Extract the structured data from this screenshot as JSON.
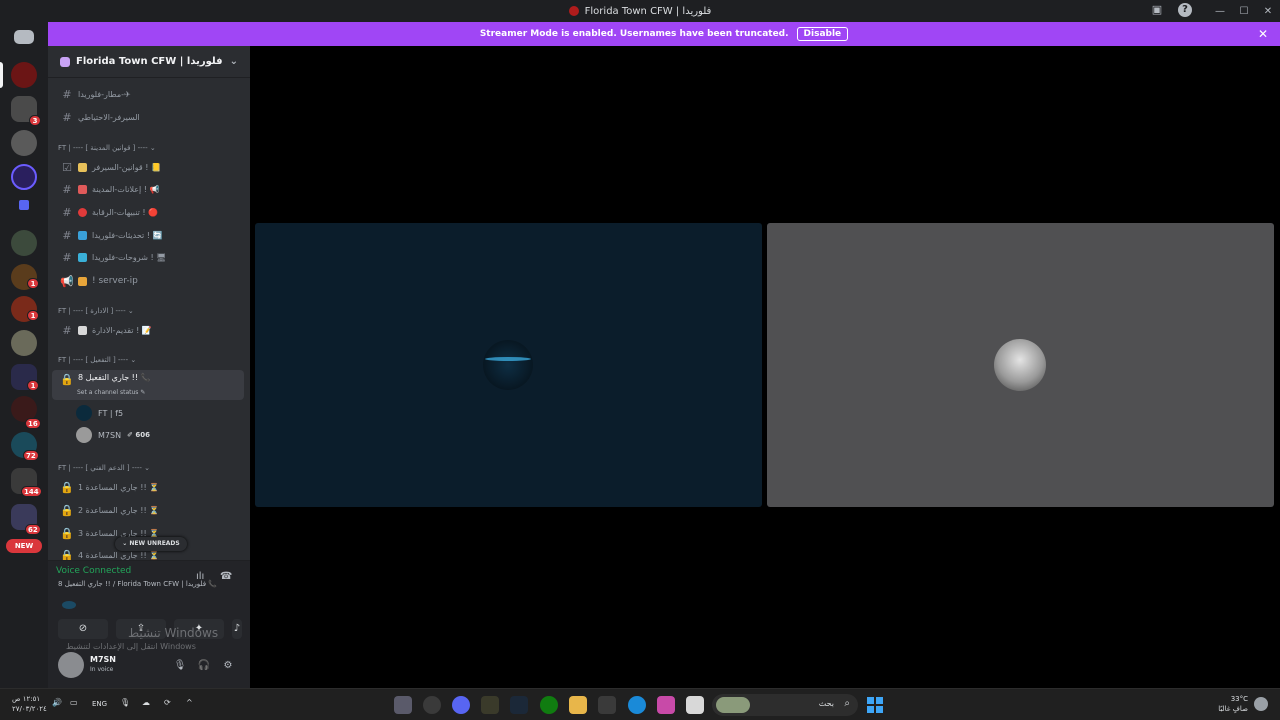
{
  "window": {
    "title": "Florida Town CFW | فلوريدا"
  },
  "banner": {
    "text": "Streamer Mode is enabled. Usernames have been truncated.",
    "disable_label": "Disable"
  },
  "rail": {
    "badges": [
      "3",
      "1",
      "1",
      "1",
      "16",
      "72",
      "144",
      "62"
    ],
    "new_label": "NEW"
  },
  "sidebar": {
    "server_name": "Florida Town CFW | فلوريدا",
    "channels_top": [
      {
        "name": "مطار-فلوريدا-✈"
      },
      {
        "name": "السيرفر-الاحتياطي"
      }
    ],
    "category1": "FT | ---- [ قوانين المدينة ] ---- ⌄",
    "category1_channels": [
      {
        "name": "قوانين-السيرفر ! 📒",
        "icon": "☑",
        "color": "#e8c15a"
      },
      {
        "name": "إعلانات-المدينة ! 📢",
        "icon": "#",
        "color": "#e05a5a"
      },
      {
        "name": "تنبيهات-الرقابة ! 🔴",
        "icon": "#",
        "color": "#e03a3a"
      },
      {
        "name": "تحديثات-فلوريدا ! 🔄",
        "icon": "#",
        "color": "#3aa0d8"
      },
      {
        "name": "شروحات-فلوريدا ! 🖥",
        "icon": "#",
        "color": "#3ab0d8"
      },
      {
        "name": "! server-ip",
        "icon": "📢",
        "color": "#e8a53a"
      }
    ],
    "category2": "FT | ---- [ الادارة ] ---- ⌄",
    "category2_channels": [
      {
        "name": "تقديم-الادارة ! 📝",
        "icon": "#",
        "color": "#d8d8d8"
      }
    ],
    "category3": "FT | ---- [ التفعيل ] ---- ⌄",
    "active_channel": "جاري التفعيل 8 !! 📞",
    "channel_status": "Set a channel status ✎",
    "voice_users": [
      {
        "name": "FT | f5",
        "tag": ""
      },
      {
        "name": "M7SN",
        "tag": "✐ 606"
      }
    ],
    "category4": "FT | ---- [ الدعم الفني ] ---- ⌄",
    "support_channels": [
      {
        "name": "جاري المساعدة 1 !! ⏳"
      },
      {
        "name": "جاري المساعدة 2 !! ⏳"
      },
      {
        "name": "جاري المساعدة 3 !! ⏳"
      },
      {
        "name": "جاري المساعدة 4 !! ⏳"
      }
    ],
    "new_unreads": "⌄ NEW UNREADS"
  },
  "voice_panel": {
    "title": "Voice Connected",
    "subtitle": "جاري التفعيل 8 !! / Florida Town CFW | فلوريدا 📞"
  },
  "user_panel": {
    "name": "M7SN",
    "status": "In voice"
  },
  "watermark": {
    "line1": "تنشيط Windows",
    "line2": "انتقل إلى الإعدادات لتنشيط Windows"
  },
  "taskbar": {
    "time": "١٢:٥١ ص",
    "date": "٢٧/٠٣/٢٠٢٤",
    "lang": "ENG",
    "search_placeholder": "بحث",
    "weather_temp": "33°C",
    "weather_desc": "صافٍ غالبًا"
  }
}
